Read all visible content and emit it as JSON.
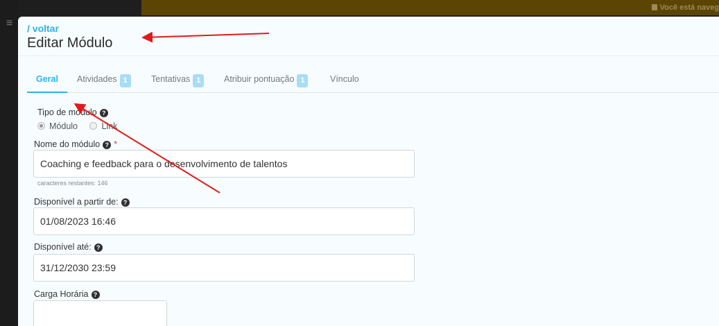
{
  "topbar": {
    "notice": "Você está naveg"
  },
  "header": {
    "back_link": "/ voltar",
    "title": "Editar Módulo"
  },
  "tabs": [
    {
      "label": "Geral",
      "badge": ""
    },
    {
      "label": "Atividades",
      "badge": "1"
    },
    {
      "label": "Tentativas",
      "badge": "1"
    },
    {
      "label": "Atribuir pontuação",
      "badge": "1"
    },
    {
      "label": "Vínculo",
      "badge": ""
    }
  ],
  "form": {
    "module_type": {
      "label": "Tipo de módulo",
      "options": [
        "Módulo",
        "Link"
      ],
      "selected": "Módulo"
    },
    "module_name": {
      "label": "Nome do módulo",
      "value": "Coaching e feedback para o desenvolvimento de talentos",
      "hint": "caracteres restantes: 146"
    },
    "available_from": {
      "label": "Disponível a partir de:",
      "value": "01/08/2023 16:46"
    },
    "available_until": {
      "label": "Disponível até:",
      "value": "31/12/2030 23:59"
    },
    "workload": {
      "label": "Carga Horária",
      "value": ""
    }
  },
  "annotation": {
    "color": "#e01b1b"
  },
  "colors": {
    "accent": "#29b3ea",
    "badge": "#a9dcf5",
    "topbar": "#5c4504"
  }
}
